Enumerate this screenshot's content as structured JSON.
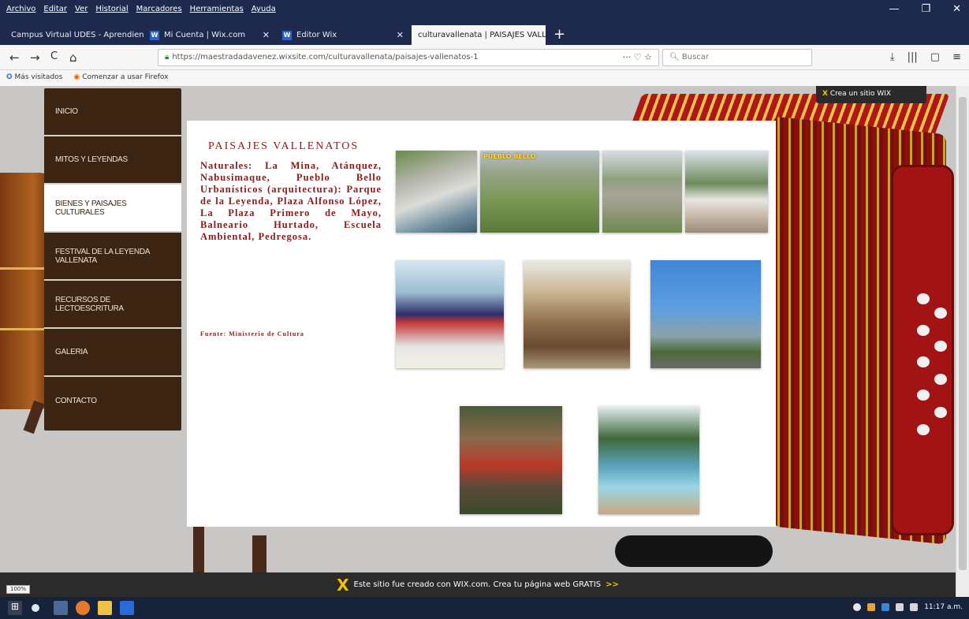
{
  "menubar": {
    "items": [
      "Archivo",
      "Editar",
      "Ver",
      "Historial",
      "Marcadores",
      "Herramientas",
      "Ayuda"
    ],
    "window_controls": [
      "—",
      "❐",
      "✕"
    ]
  },
  "tabs": [
    {
      "label": "Campus Virtual UDES - Aprendiente",
      "icon": "C"
    },
    {
      "label": "Mi Cuenta | Wix.com",
      "icon": "W"
    },
    {
      "label": "Editor Wix",
      "icon": "W"
    },
    {
      "label": "culturavallenata | PAISAJES VALLEN",
      "icon": "c"
    }
  ],
  "navbar": {
    "back": "←",
    "forward": "→",
    "reload": "C",
    "home": "⌂",
    "url": "https://maestradadavenez.wixsite.com/culturavallenata/paisajes-vallenatos-1",
    "url_actions": "··· ♡ ☆",
    "search_placeholder": "Buscar",
    "right_icons": [
      "⤓",
      "|||",
      "▢",
      "≡"
    ]
  },
  "bookmarks": [
    {
      "label": "Más visitados",
      "icon": "✪"
    },
    {
      "label": "Comenzar a usar Firefox",
      "icon": "◉"
    }
  ],
  "wix_badge": {
    "x": "X",
    "label": "Crea un sitio WIX"
  },
  "site_nav": [
    {
      "label": "INICIO",
      "active": false
    },
    {
      "label": "MITOS Y LEYENDAS",
      "active": false
    },
    {
      "label": "BIENES Y PAISAJES CULTURALES",
      "active": true
    },
    {
      "label": "FESTIVAL DE LA LEYENDA VALLENATA",
      "active": false
    },
    {
      "label": "RECURSOS DE LECTOESCRITURA",
      "active": false
    },
    {
      "label": "GALERIA",
      "active": false
    },
    {
      "label": "CONTACTO",
      "active": false
    }
  ],
  "content": {
    "title": "PAISAJES VALLENATOS",
    "body": "Naturales: La Mina, Atánquez, Nabusimaque, Pueblo Bello Urbanísticos (arquitectura): Parque de la Leyenda, Plaza Alfonso López, La Plaza Primero de Mayo, Balneario Hurtado, Escuela Ambiental, Pedregosa.",
    "source": "Fuente: Ministerio de Cultura",
    "photo_label_pueblo": "PUEBLO BELLO"
  },
  "wixbar": {
    "x": "X",
    "text": "Este sitio fue creado con WIX.com. Crea tu página web GRATIS",
    "arrows": ">>"
  },
  "zoom": "100%",
  "tray": {
    "time": "11:17 a.m."
  }
}
